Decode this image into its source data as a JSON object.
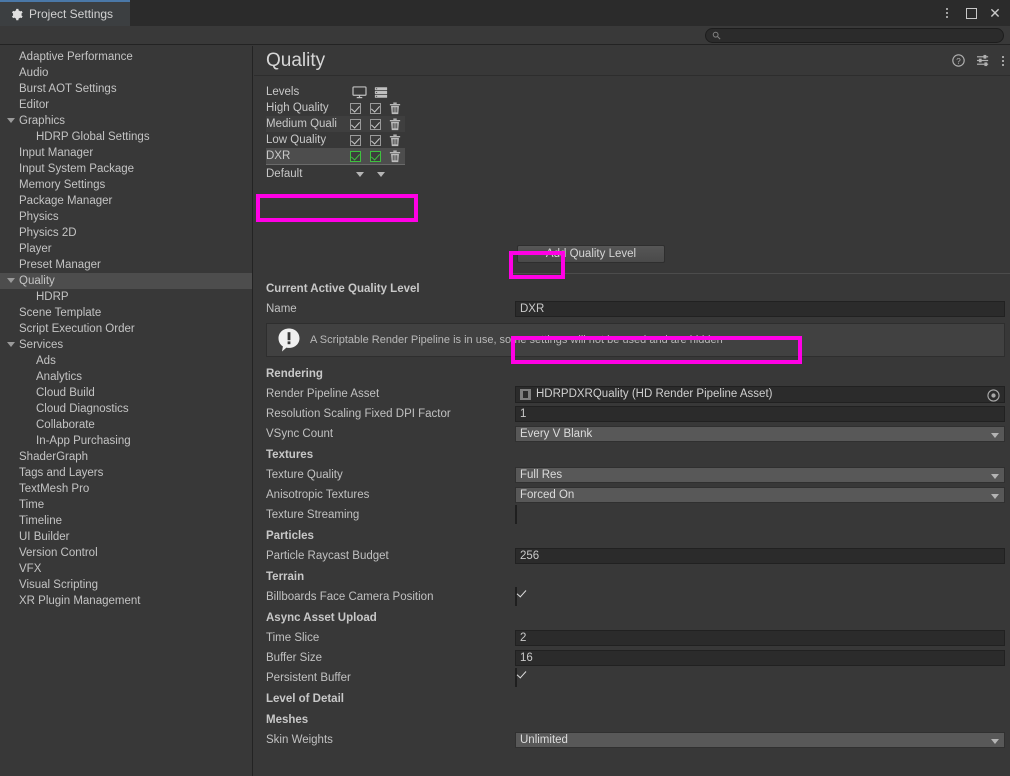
{
  "window": {
    "tab_title": "Project Settings",
    "tab_icon": "gear-icon",
    "controls": [
      "more-options-icon",
      "maximize-icon",
      "close-icon"
    ]
  },
  "search": {
    "value": "",
    "placeholder": "",
    "icon": "search-icon"
  },
  "sidebar": {
    "items": [
      {
        "label": "Adaptive Performance",
        "indent": 0,
        "arrow": false,
        "selected": false
      },
      {
        "label": "Audio",
        "indent": 0,
        "arrow": false,
        "selected": false
      },
      {
        "label": "Burst AOT Settings",
        "indent": 0,
        "arrow": false,
        "selected": false
      },
      {
        "label": "Editor",
        "indent": 0,
        "arrow": false,
        "selected": false
      },
      {
        "label": "Graphics",
        "indent": 0,
        "arrow": true,
        "selected": false
      },
      {
        "label": "HDRP Global Settings",
        "indent": 1,
        "arrow": false,
        "selected": false
      },
      {
        "label": "Input Manager",
        "indent": 0,
        "arrow": false,
        "selected": false
      },
      {
        "label": "Input System Package",
        "indent": 0,
        "arrow": false,
        "selected": false
      },
      {
        "label": "Memory Settings",
        "indent": 0,
        "arrow": false,
        "selected": false
      },
      {
        "label": "Package Manager",
        "indent": 0,
        "arrow": false,
        "selected": false
      },
      {
        "label": "Physics",
        "indent": 0,
        "arrow": false,
        "selected": false
      },
      {
        "label": "Physics 2D",
        "indent": 0,
        "arrow": false,
        "selected": false
      },
      {
        "label": "Player",
        "indent": 0,
        "arrow": false,
        "selected": false
      },
      {
        "label": "Preset Manager",
        "indent": 0,
        "arrow": false,
        "selected": false
      },
      {
        "label": "Quality",
        "indent": 0,
        "arrow": true,
        "selected": true
      },
      {
        "label": "HDRP",
        "indent": 1,
        "arrow": false,
        "selected": false
      },
      {
        "label": "Scene Template",
        "indent": 0,
        "arrow": false,
        "selected": false
      },
      {
        "label": "Script Execution Order",
        "indent": 0,
        "arrow": false,
        "selected": false
      },
      {
        "label": "Services",
        "indent": 0,
        "arrow": true,
        "selected": false
      },
      {
        "label": "Ads",
        "indent": 1,
        "arrow": false,
        "selected": false
      },
      {
        "label": "Analytics",
        "indent": 1,
        "arrow": false,
        "selected": false
      },
      {
        "label": "Cloud Build",
        "indent": 1,
        "arrow": false,
        "selected": false
      },
      {
        "label": "Cloud Diagnostics",
        "indent": 1,
        "arrow": false,
        "selected": false
      },
      {
        "label": "Collaborate",
        "indent": 1,
        "arrow": false,
        "selected": false
      },
      {
        "label": "In-App Purchasing",
        "indent": 1,
        "arrow": false,
        "selected": false
      },
      {
        "label": "ShaderGraph",
        "indent": 0,
        "arrow": false,
        "selected": false
      },
      {
        "label": "Tags and Layers",
        "indent": 0,
        "arrow": false,
        "selected": false
      },
      {
        "label": "TextMesh Pro",
        "indent": 0,
        "arrow": false,
        "selected": false
      },
      {
        "label": "Time",
        "indent": 0,
        "arrow": false,
        "selected": false
      },
      {
        "label": "Timeline",
        "indent": 0,
        "arrow": false,
        "selected": false
      },
      {
        "label": "UI Builder",
        "indent": 0,
        "arrow": false,
        "selected": false
      },
      {
        "label": "Version Control",
        "indent": 0,
        "arrow": false,
        "selected": false
      },
      {
        "label": "VFX",
        "indent": 0,
        "arrow": false,
        "selected": false
      },
      {
        "label": "Visual Scripting",
        "indent": 0,
        "arrow": false,
        "selected": false
      },
      {
        "label": "XR Plugin Management",
        "indent": 0,
        "arrow": false,
        "selected": false
      }
    ]
  },
  "main": {
    "page_title": "Quality",
    "header_icons": [
      "help-icon",
      "preset-icon",
      "more-options-icon"
    ],
    "levels": {
      "label": "Levels",
      "column_icons": [
        "monitor-icon",
        "server-rack-icon"
      ],
      "rows": [
        {
          "name": "High Quality",
          "desktop": true,
          "server": true,
          "selected": false
        },
        {
          "name": "Medium Quali",
          "desktop": true,
          "server": true,
          "selected": false
        },
        {
          "name": "Low Quality",
          "desktop": true,
          "server": true,
          "selected": false
        },
        {
          "name": "DXR",
          "desktop": true,
          "server": true,
          "selected": true
        }
      ],
      "default_label": "Default",
      "add_button": "Add Quality Level"
    },
    "current_level": {
      "section": "Current Active Quality Level",
      "name_label": "Name",
      "name_value": "DXR",
      "help_text": "A Scriptable Render Pipeline is in use, some settings will not be used and are hidden",
      "help_icon": "info-exclamation-icon"
    },
    "sections": [
      {
        "title": "Rendering",
        "fields": [
          {
            "label": "Render Pipeline Asset",
            "type": "object",
            "value": "HDRPDXRQuality (HD Render Pipeline Asset)",
            "icon": "asset-icon",
            "picker": "object-picker-icon"
          },
          {
            "label": "Resolution Scaling Fixed DPI Factor",
            "type": "text",
            "value": "1"
          },
          {
            "label": "VSync Count",
            "type": "dropdown",
            "value": "Every V Blank"
          }
        ]
      },
      {
        "title": "Textures",
        "fields": [
          {
            "label": "Texture Quality",
            "type": "dropdown",
            "value": "Full Res"
          },
          {
            "label": "Anisotropic Textures",
            "type": "dropdown",
            "value": "Forced On"
          },
          {
            "label": "Texture Streaming",
            "type": "checkbox",
            "checked": false
          }
        ]
      },
      {
        "title": "Particles",
        "fields": [
          {
            "label": "Particle Raycast Budget",
            "type": "text",
            "value": "256"
          }
        ]
      },
      {
        "title": "Terrain",
        "fields": [
          {
            "label": "Billboards Face Camera Position",
            "type": "checkbox",
            "checked": true
          }
        ]
      },
      {
        "title": "Async Asset Upload",
        "fields": [
          {
            "label": "Time Slice",
            "type": "text",
            "value": "2"
          },
          {
            "label": "Buffer Size",
            "type": "text",
            "value": "16"
          },
          {
            "label": "Persistent Buffer",
            "type": "checkbox",
            "checked": true
          }
        ]
      },
      {
        "title": "Level of Detail",
        "fields": []
      },
      {
        "title": "Meshes",
        "fields": [
          {
            "label": "Skin Weights",
            "type": "dropdown",
            "value": "Unlimited"
          }
        ]
      }
    ]
  },
  "highlights": {
    "color": "#ff00e5",
    "boxes": [
      {
        "name": "add-quality-level-highlight"
      },
      {
        "name": "name-field-highlight"
      },
      {
        "name": "render-pipeline-asset-highlight"
      }
    ]
  }
}
